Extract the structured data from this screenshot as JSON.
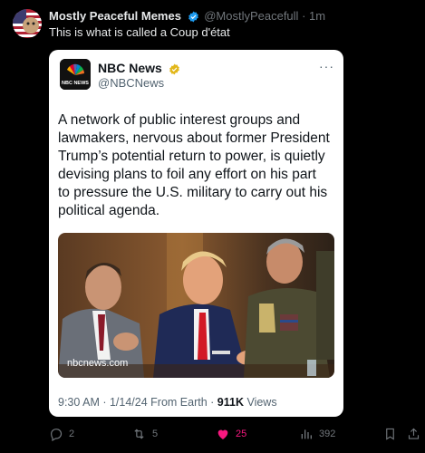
{
  "author": {
    "display_name": "Mostly Peaceful Memes",
    "handle": "@MostlyPeacefull",
    "time": "1m"
  },
  "tweet_text": "This is what is called a Coup d'état",
  "quoted": {
    "name": "NBC News",
    "handle": "@NBCNews",
    "logo_text": "NBC NEWS",
    "body": "A network of public interest groups and lawmakers, nervous about former President Trump’s potential return to power, is quietly devising plans to foil any effort on his part to pressure the U.S. military to carry out his political agenda.",
    "image_caption": "nbcnews.com",
    "timestamp": "9:30 AM · 1/14/24 From Earth · ",
    "views_count": "911K",
    "views_label": " Views"
  },
  "actions": {
    "reply_count": "2",
    "retweet_count": "5",
    "like_count": "25",
    "view_count": "392"
  },
  "colors": {
    "like_active": "#f91880",
    "verified_blue": "#1d9bf0",
    "verified_gold": "#e2b719",
    "muted": "#71767b"
  },
  "icons": [
    "verified-badge-icon",
    "more-icon",
    "reply-icon",
    "retweet-icon",
    "heart-icon",
    "views-icon",
    "bookmark-icon",
    "share-icon"
  ]
}
